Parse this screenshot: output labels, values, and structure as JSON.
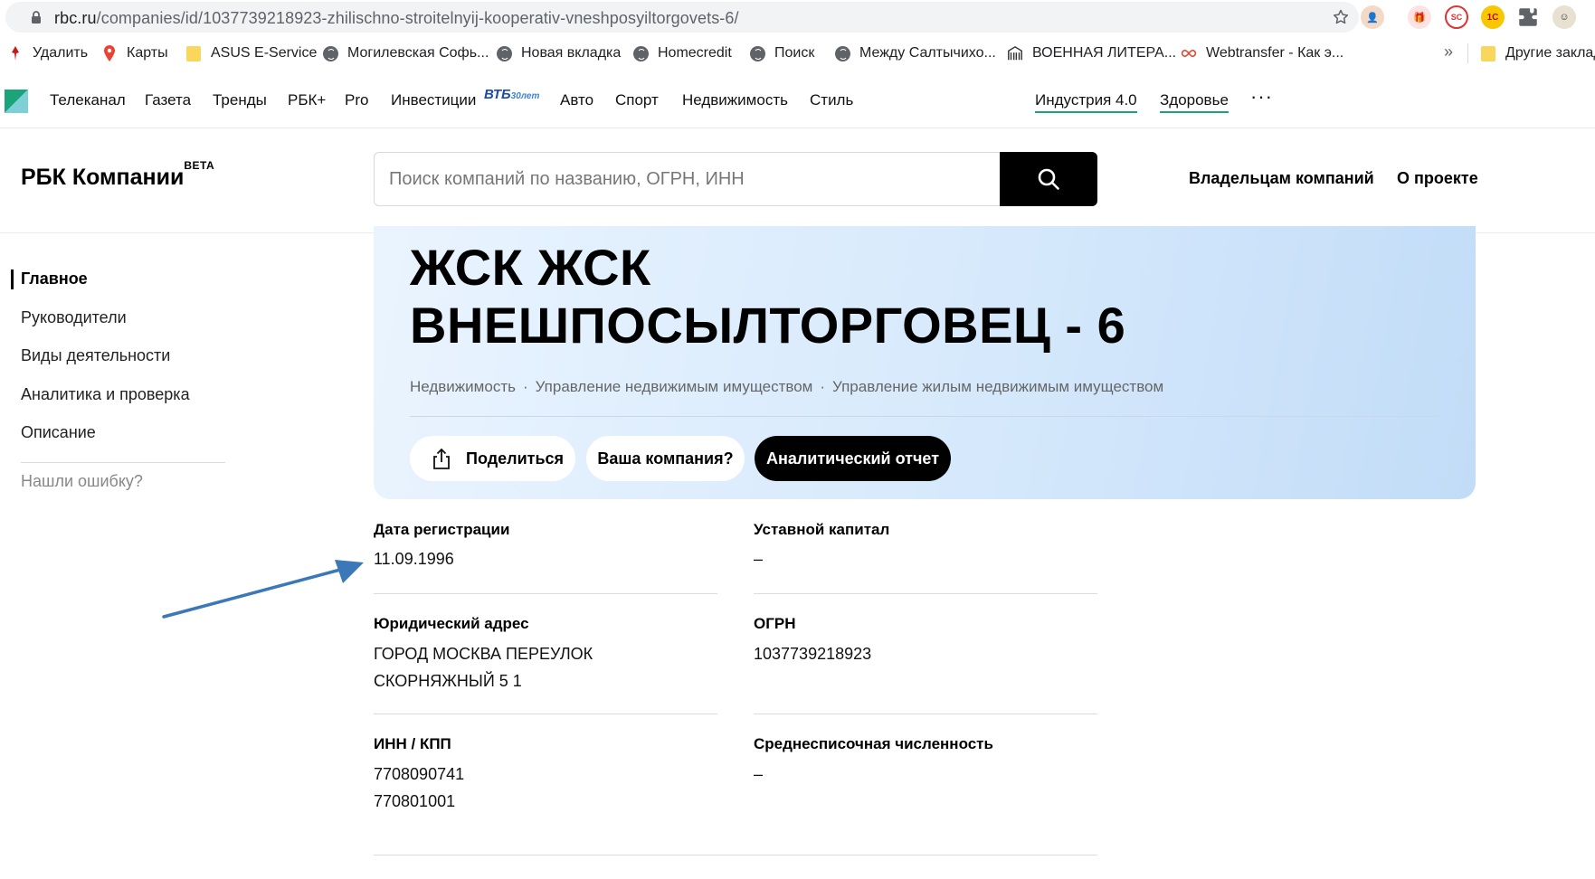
{
  "browser": {
    "url_host": "rbc.ru",
    "url_path": "/companies/id/1037739218923-zhilischno-stroitelnyij-kooperativ-vneshposyiltorgovets-6/",
    "bookmarks": [
      {
        "label": "Удалить",
        "icon": "pin-icon"
      },
      {
        "label": "Карты",
        "icon": "maps-icon"
      },
      {
        "label": "ASUS E-Service",
        "icon": "folder-icon"
      },
      {
        "label": "Могилевская Софь...",
        "icon": "globe-icon"
      },
      {
        "label": "Новая вкладка",
        "icon": "globe-icon"
      },
      {
        "label": "Homecredit",
        "icon": "globe-icon"
      },
      {
        "label": "Поиск",
        "icon": "globe-icon"
      },
      {
        "label": "Между Салтычихо...",
        "icon": "globe-icon"
      },
      {
        "label": "ВОЕННАЯ ЛИТЕРА...",
        "icon": "building-icon"
      },
      {
        "label": "Webtransfer - Как э...",
        "icon": "infinity-icon"
      }
    ],
    "more_bookmarks": "»",
    "other_bookmarks": "Другие заклад"
  },
  "topnav": {
    "items": [
      "Телеканал",
      "Газета",
      "Тренды",
      "РБК+",
      "Pro",
      "Инвестиции",
      "Авто",
      "Спорт",
      "Недвижимость",
      "Стиль"
    ],
    "partner": "ВТБ",
    "partner_sub": "30лет",
    "featured": [
      "Индустрия 4.0",
      "Здоровье"
    ],
    "more": "···"
  },
  "header": {
    "brand": "РБК Компании",
    "brand_tag": "BETA",
    "search_placeholder": "Поиск компаний по названию, ОГРН, ИНН",
    "links": [
      "Владельцам компаний",
      "О проекте"
    ]
  },
  "sidebar": {
    "items": [
      "Главное",
      "Руководители",
      "Виды деятельности",
      "Аналитика и проверка",
      "Описание"
    ],
    "active_index": 0,
    "report_error": "Нашли ошибку?"
  },
  "company": {
    "title_line1": "ЖСК ЖСК",
    "title_line2": "ВНЕШПОСЫЛТОРГОВЕЦ - 6",
    "categories": [
      "Недвижимость",
      "Управление недвижимым имуществом",
      "Управление жилым недвижимым имуществом"
    ],
    "category_sep": "·",
    "buttons": {
      "share": "Поделиться",
      "your_company": "Ваша компания?",
      "report": "Аналитический отчет"
    }
  },
  "info": {
    "reg_date_label": "Дата регистрации",
    "reg_date": "11.09.1996",
    "capital_label": "Уставной капитал",
    "capital": "–",
    "address_label": "Юридический адрес",
    "address_line1": "ГОРОД МОСКВА ПЕРЕУЛОК",
    "address_line2": "СКОРНЯЖНЫЙ 5 1",
    "ogrn_label": "ОГРН",
    "ogrn": "1037739218923",
    "inn_kpp_label": "ИНН / КПП",
    "inn": "7708090741",
    "kpp": "770801001",
    "headcount_label": "Среднесписочная численность",
    "headcount": "–"
  },
  "colors": {
    "accent_green": "#1ba37a",
    "annotation_arrow": "#3a78b8",
    "hero_gradient_start": "#eaf4fe",
    "hero_gradient_end": "#c2dcf7"
  }
}
